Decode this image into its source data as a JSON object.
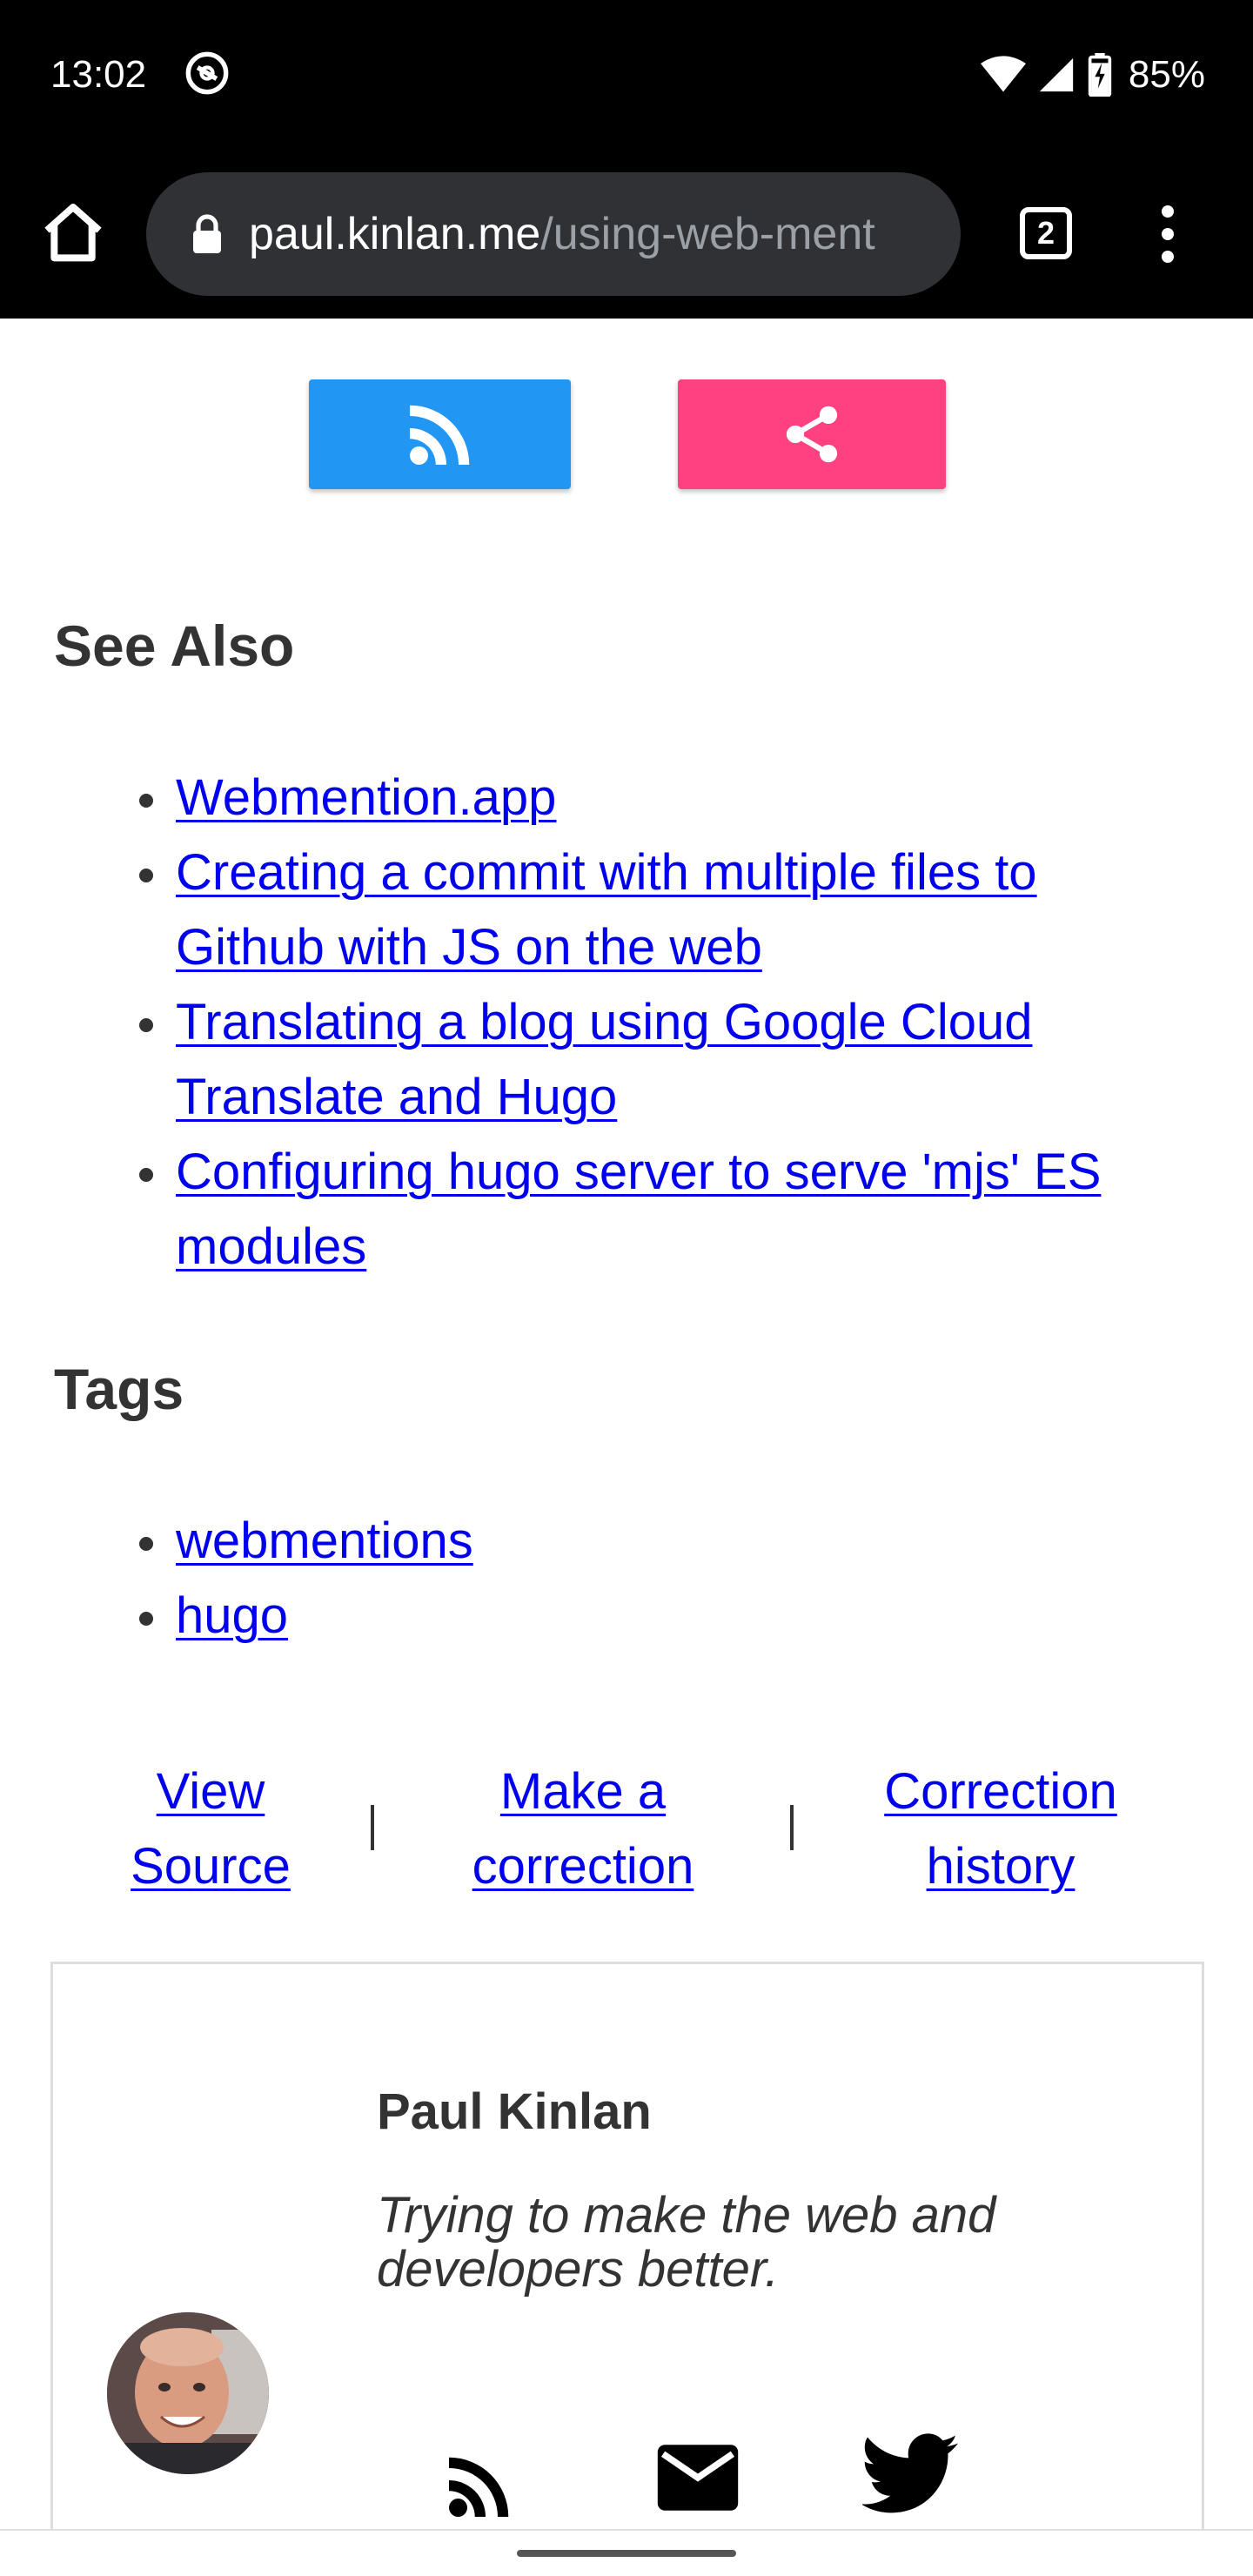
{
  "status_bar": {
    "time": "13:02",
    "battery": "85%"
  },
  "toolbar": {
    "url_domain": "paul.kinlan.me",
    "url_path": "/using-web-ment",
    "tab_count": "2"
  },
  "colors": {
    "rss_button": "#2196f3",
    "share_button": "#ff4081",
    "link": "#0000ee"
  },
  "see_also": {
    "heading": "See Also",
    "items": [
      {
        "line1": "Webmention.app",
        "line2": ""
      },
      {
        "line1": "Creating a commit with multiple files to",
        "line2": "Github with JS on the web"
      },
      {
        "line1": "Translating a blog using Google Cloud",
        "line2": "Translate and Hugo"
      },
      {
        "line1": "Configuring hugo server to serve 'mjs' ES",
        "line2": "modules"
      }
    ]
  },
  "tags": {
    "heading": "Tags",
    "items": [
      "webmentions",
      "hugo"
    ]
  },
  "footer_links": {
    "view_source": {
      "line1": "View",
      "line2": "Source"
    },
    "make_correction": {
      "line1": "Make a",
      "line2": "correction"
    },
    "correction_history": {
      "line1": "Correction",
      "line2": "history"
    }
  },
  "author": {
    "name": "Paul Kinlan",
    "bio_line1": "Trying to make the web and",
    "bio_line2": "developers better."
  },
  "icons": [
    "home-icon",
    "lock-icon",
    "tab-switcher-icon",
    "more-vert-icon",
    "rss-icon",
    "share-icon",
    "email-icon",
    "twitter-icon"
  ]
}
